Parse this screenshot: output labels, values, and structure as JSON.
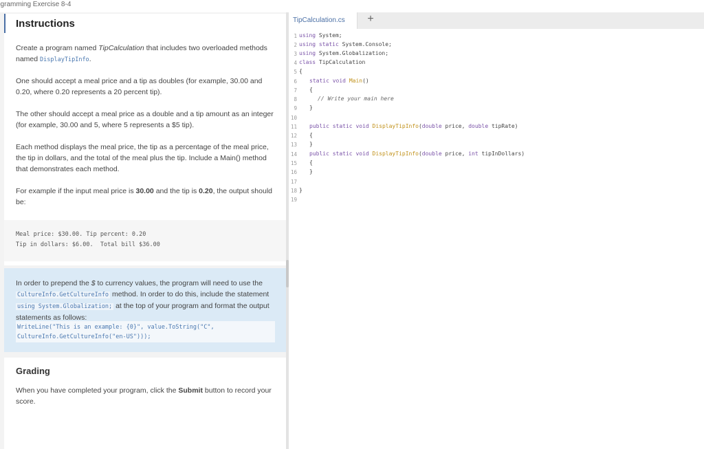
{
  "window": {
    "title": "ogramming Exercise 8-4"
  },
  "instructions": {
    "heading": "Instructions",
    "p1_a": "Create a program named ",
    "p1_b": "TipCalculation",
    "p1_c": " that includes two overloaded methods named ",
    "p1_d": "DisplayTipInfo",
    "p1_e": ".",
    "p2": "One should accept a meal price and a tip as doubles (for example, 30.00 and 0.20, where 0.20 represents a 20 percent tip).",
    "p3": "The other should accept a meal price as a double and a tip amount as an integer (for example, 30.00 and 5, where 5 represents a $5 tip).",
    "p4": "Each method displays the meal price, the tip as a percentage of the meal price, the tip in dollars, and the total of the meal plus the tip. Include a Main() method that demonstrates each method.",
    "p5_a": "For example if the input meal price is ",
    "p5_b": "30.00",
    "p5_c": " and the tip is ",
    "p5_d": "0.20",
    "p5_e": ", the output should be:",
    "example_line1": "Meal price: $30.00. Tip percent: 0.20",
    "example_line2": "Tip in dollars: $6.00.  Total bill $36.00"
  },
  "note": {
    "t1": "In order to prepend the ",
    "t2": "$",
    "t3": " to currency values, the program will need to use the ",
    "t4": "CultureInfo.GetCultureInfo",
    "t5": " method. In order to do this, include the statement ",
    "t6": "using System.Globalization;",
    "t7": " at the top of your program and format the output statements as follows:",
    "code1": "WriteLine(\"This is an example: {0}\", value.ToString(\"C\",",
    "code2": "CultureInfo.GetCultureInfo(\"en-US\")));"
  },
  "grading": {
    "heading": "Grading",
    "t1": "When you have completed your program, click the ",
    "t2": "Submit",
    "t3": " button to record your score."
  },
  "editor": {
    "tab_label": "TipCalculation.cs",
    "add_tab_symbol": "+",
    "line_numbers": [
      "1",
      "2",
      "3",
      "4",
      "5",
      "6",
      "7",
      "8",
      "9",
      "10",
      "11",
      "12",
      "13",
      "14",
      "15",
      "16",
      "17",
      "18",
      "19"
    ],
    "lines": {
      "l1a": "using",
      "l1b": " System;",
      "l2a": "using",
      "l2b": " static",
      "l2c": " System.Console;",
      "l3a": "using",
      "l3b": " System.Globalization;",
      "l4a": "class",
      "l4b": " TipCalculation",
      "l5": "{",
      "l6a": "static",
      "l6b": " void",
      "l6c": " Main",
      "l6d": "()",
      "l7": "{",
      "l8": "// Write your main here",
      "l9": "}",
      "l11a": "public",
      "l11b": " static",
      "l11c": " void",
      "l11d": " DisplayTipInfo",
      "l11e": "(",
      "l11f": "double",
      "l11g": " price, ",
      "l11h": "double",
      "l11i": " tipRate)",
      "l12": "{",
      "l13": "}",
      "l14a": "public",
      "l14b": " static",
      "l14c": " void",
      "l14d": " DisplayTipInfo",
      "l14e": "(",
      "l14f": "double",
      "l14g": " price, ",
      "l14h": "int",
      "l14i": " tipInDollars)",
      "l15": "{",
      "l16": "}",
      "l18": "}"
    }
  }
}
